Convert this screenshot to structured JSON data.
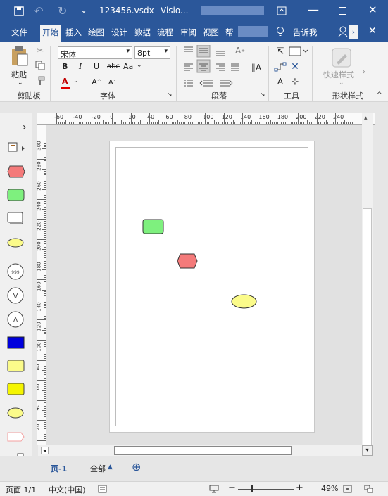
{
  "titlebar": {
    "filename": "123456.vsdx",
    "separator": "-",
    "app": "Visio..."
  },
  "tabs": [
    {
      "label": "文件"
    },
    {
      "label": "开始"
    },
    {
      "label": "插入"
    },
    {
      "label": "绘图"
    },
    {
      "label": "设计"
    },
    {
      "label": "数据"
    },
    {
      "label": "流程"
    },
    {
      "label": "审阅"
    },
    {
      "label": "视图"
    },
    {
      "label": "帮"
    }
  ],
  "tellme": "告诉我",
  "ribbon": {
    "paste": "粘贴",
    "font_name": "宋体",
    "font_size": "8pt",
    "bold": "B",
    "italic": "I",
    "underline": "U",
    "strike": "abc",
    "case": "Aa",
    "font_color": "A",
    "quick_styles": "快速样式",
    "groups": {
      "clipboard": "剪贴板",
      "font": "字体",
      "paragraph": "段落",
      "tools": "工具",
      "shape_styles": "形状样式"
    }
  },
  "ruler_h": [
    "-60",
    "-40",
    "-20",
    "0",
    "20",
    "40",
    "60",
    "80",
    "100",
    "120",
    "140",
    "160",
    "180",
    "200",
    "220",
    "240"
  ],
  "ruler_v": [
    "300",
    "280",
    "260",
    "240",
    "220",
    "200",
    "180",
    "160",
    "140",
    "120",
    "100",
    "80",
    "60",
    "40",
    "20",
    "0"
  ],
  "pagetabs": {
    "page": "页-1",
    "all": "全部",
    "add": "⊕"
  },
  "status": {
    "page": "页面 1/1",
    "lang": "中文(中国)",
    "zoom": "49%"
  },
  "colors": {
    "accent": "#2b579a",
    "green": "#7ef07e",
    "red": "#f47a7a",
    "yellow": "#fbfb8a",
    "blue": "#0000dd"
  }
}
